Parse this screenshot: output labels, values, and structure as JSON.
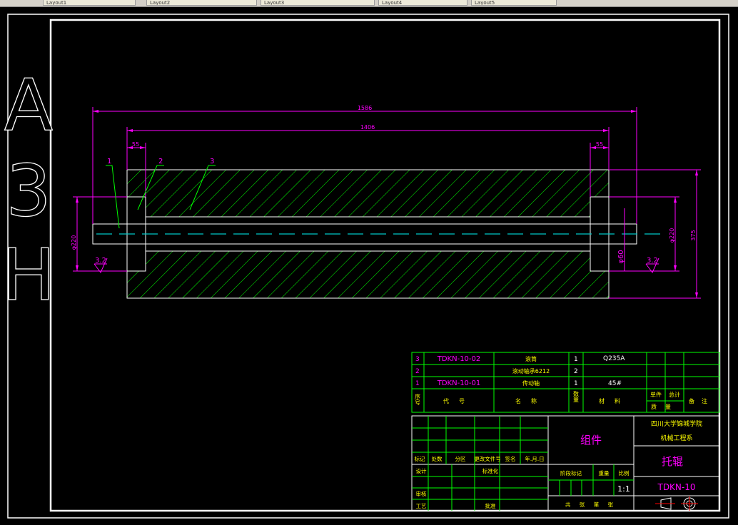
{
  "tabs": [
    {
      "label": "Layout1"
    },
    {
      "label": "Layout2"
    },
    {
      "label": "Layout3"
    },
    {
      "label": "Layout4"
    },
    {
      "label": "Layout5"
    }
  ],
  "sheet_code": {
    "a": "A",
    "n": "3",
    "h": "H"
  },
  "dimensions": {
    "overall_length": "1586",
    "inner_length": "1406",
    "left_offset": "55",
    "right_offset": "55",
    "left_diameter": "φ220",
    "right_diameter": "φ220",
    "overall_height": "375",
    "shaft_diameter": "φ60",
    "roughness_left": "3.2",
    "roughness_right": "3.2"
  },
  "balloons": [
    "1",
    "2",
    "3"
  ],
  "parts_list": {
    "rows": [
      {
        "no": "3",
        "code": "TDKN-10-02",
        "name": "滚筒",
        "qty": "1",
        "material": "Q235A"
      },
      {
        "no": "2",
        "code": "",
        "name": "滚动轴承6212",
        "qty": "2",
        "material": ""
      },
      {
        "no": "1",
        "code": "TDKN-10-01",
        "name": "传动轴",
        "qty": "1",
        "material": "45#"
      }
    ],
    "headers": {
      "no": "序号",
      "code": "代号",
      "name": "名称",
      "qty": "数量",
      "material": "材料",
      "single": "单件",
      "total": "总计",
      "mass": "质量",
      "remark": "备注"
    }
  },
  "title_block": {
    "revision_labels": [
      "标记",
      "处数",
      "分区",
      "更改文件号",
      "签名",
      "年.月.日"
    ],
    "design": "设计",
    "standard": "标准化",
    "review": "审核",
    "process": "工艺",
    "approve": "批准",
    "stage_mark": "阶段标记",
    "weight": "重量",
    "scale_label": "比例",
    "scale": "1:1",
    "sheet_info": "共 张 第 张",
    "assembly": "组件",
    "school": "四川大学锦城学院",
    "department": "机械工程系",
    "drawing_name": "托辊",
    "drawing_no": "TDKN-10"
  },
  "colors": {
    "frame": "#ffffff",
    "dims": "#ff00ff",
    "hatch": "#00ff00",
    "center": "#00c8c8",
    "table": "#00ff00"
  }
}
